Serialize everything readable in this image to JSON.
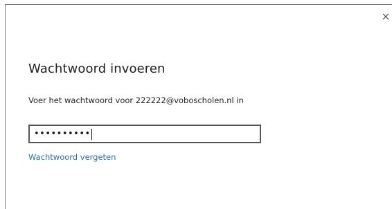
{
  "dialog": {
    "title": "Wachtwoord invoeren",
    "prompt": "Voer het wachtwoord voor 222222@voboscholen.nl in",
    "password": {
      "masked_value": "••••••••••",
      "length": 10
    },
    "forgot_link": "Wachtwoord vergeten",
    "close_icon": "close-icon"
  }
}
